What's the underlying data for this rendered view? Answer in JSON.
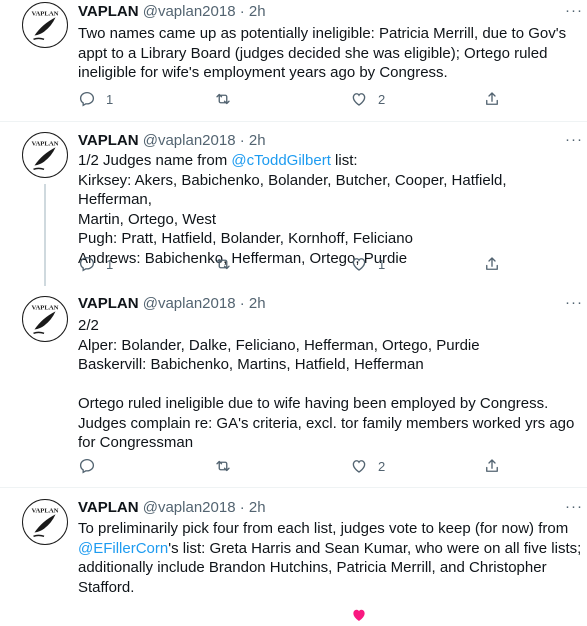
{
  "account": {
    "name": "VAPLAN",
    "handle": "@vaplan2018",
    "sep": "·",
    "avatar_text": "VAPLAN"
  },
  "colors": {
    "text": "#0f1419",
    "muted": "#536471",
    "link": "#1d9bf0",
    "like": "#f91880"
  },
  "tweets": [
    {
      "time": "2h",
      "lines": [
        "Two names came up as potentially ineligible: Patricia Merrill, due to Gov's",
        "appt to a Library Board (judges decided she was eligible); Ortego ruled",
        "ineligible for wife's employment years ago by Congress."
      ],
      "reply_count": "1",
      "retweet_count": "",
      "like_count": "2"
    },
    {
      "time": "2h",
      "line0_pre": "1/2 Judges name from ",
      "line0_mention": "@cTodd­Gilbert",
      "line0_post": " list:",
      "lines": [
        "Kirksey: Akers, Babichenko, Bolander, Butcher, Cooper, Hatfield, Hefferman,",
        "Martin, Ortego, West",
        "Pugh: Pratt, Hatfield, Bolander, Kornhoff, Feliciano",
        "Andrews: Babichenko, Hefferman, Ortego, Purdie"
      ],
      "reply_count": "1",
      "retweet_count": "",
      "like_count": "1"
    },
    {
      "time": "2h",
      "lines": [
        "2/2",
        "Alper: Bolander, Dalke, Feliciano, Hefferman, Ortego, Purdie",
        "Baskervill: Babichenko, Martins, Hatfield, Hefferman",
        "",
        "Ortego ruled ineligible due to wife having been employed by Congress.",
        "Judges complain re: GA's criteria, excl. tor family members worked yrs ago",
        "for Congressman"
      ],
      "reply_count": "",
      "retweet_count": "",
      "like_count": "2"
    },
    {
      "time": "2h",
      "line0": "To preliminarily pick four from each list, judges vote to keep (for now) from",
      "line1_mention": "@EFillerCorn",
      "line1_post": "'s list: Greta Harris and Sean Kumar, who were on all five lists;",
      "lines": [
        "additionally include Brandon Hutchins,  Patricia Merrill, and Christopher",
        "Stafford."
      ]
    }
  ]
}
